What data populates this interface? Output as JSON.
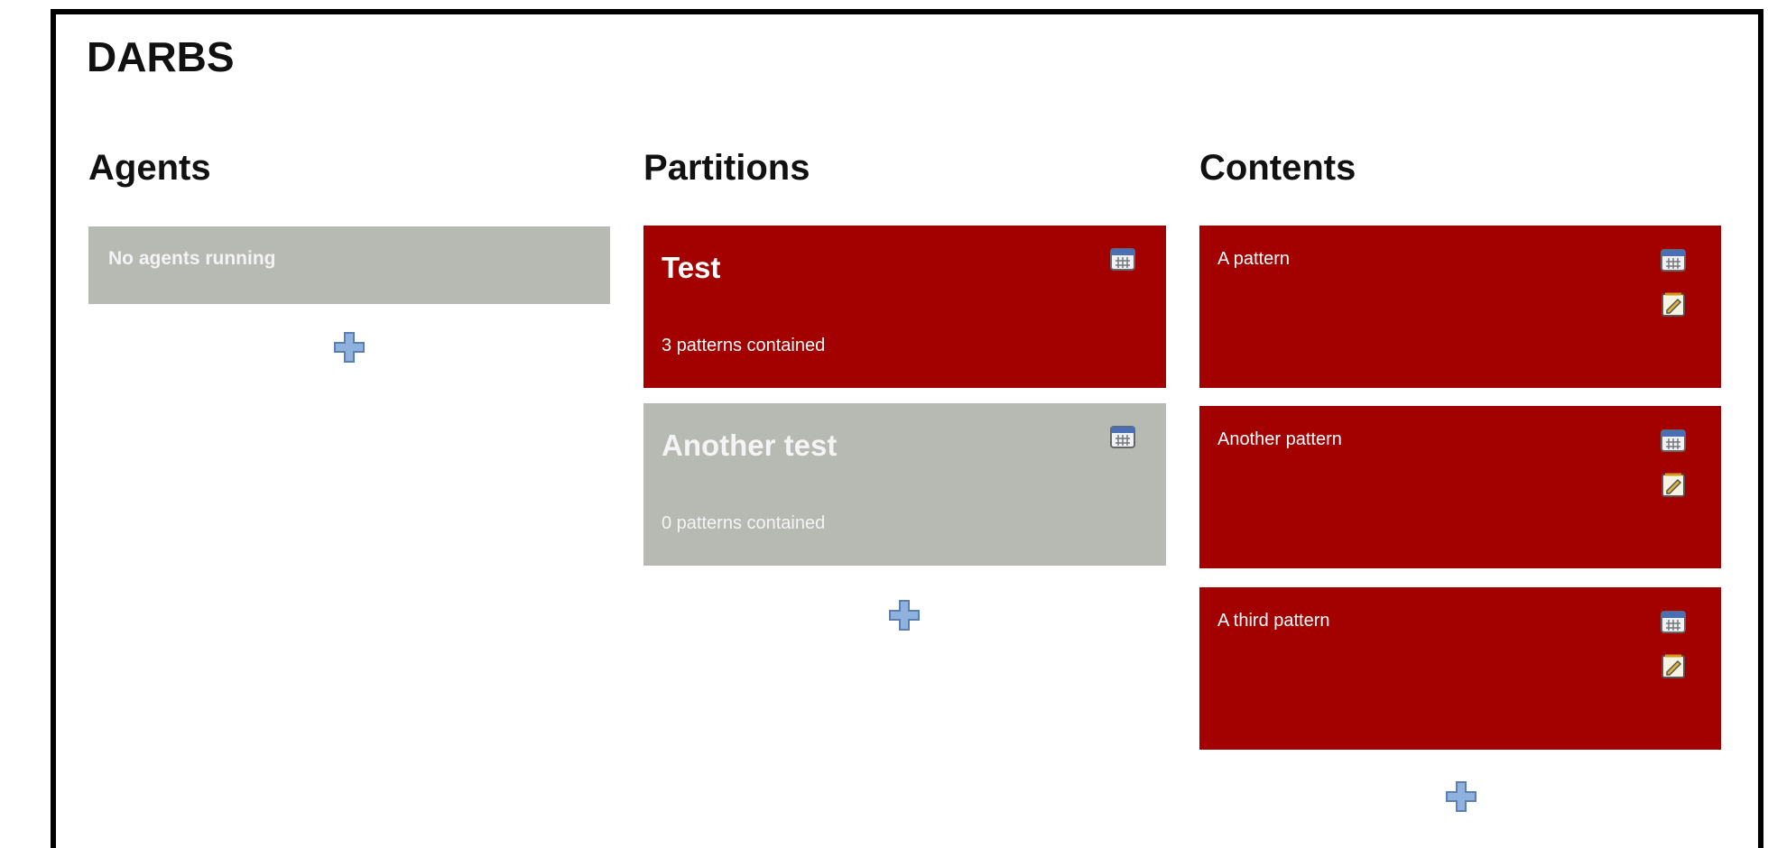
{
  "app": {
    "title": "DARBS"
  },
  "columns": {
    "agents": {
      "title": "Agents",
      "empty_message": "No agents running",
      "add_icon": "plus-icon"
    },
    "partitions": {
      "title": "Partitions",
      "items": [
        {
          "name": "Test",
          "summary": "3 patterns contained",
          "state": "active",
          "icon": "calendar-icon"
        },
        {
          "name": "Another test",
          "summary": "0 patterns contained",
          "state": "inactive",
          "icon": "calendar-icon"
        }
      ],
      "add_icon": "plus-icon"
    },
    "contents": {
      "title": "Contents",
      "items": [
        {
          "label": "A pattern",
          "icons": [
            "calendar-icon",
            "edit-icon"
          ]
        },
        {
          "label": "Another pattern",
          "icons": [
            "calendar-icon",
            "edit-icon"
          ]
        },
        {
          "label": "A third pattern",
          "icons": [
            "calendar-icon",
            "edit-icon"
          ]
        }
      ],
      "add_icon": "plus-icon"
    }
  },
  "colors": {
    "active": "#a30000",
    "inactive": "#b7b9b3",
    "border": "#000000",
    "plus": "#7ea4d4"
  }
}
